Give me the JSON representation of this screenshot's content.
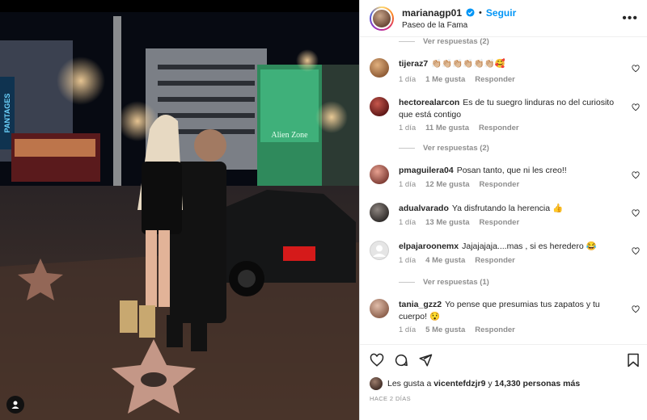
{
  "post": {
    "username": "marianagp01",
    "follow_label": "Seguir",
    "location": "Paseo de la Fama",
    "more_label": "•••",
    "separator": "•"
  },
  "photo": {
    "sign_text": "PANTAGES",
    "billboard_text": "Alien Zone"
  },
  "comments": [
    {
      "type": "replies",
      "label": "Ver respuestas (2)"
    },
    {
      "type": "comment",
      "user": "tijeraz7",
      "text": "👏🏼👏🏼👏🏼👏🏼👏🏼👏🏼🥰",
      "time": "1 día",
      "likes": "1 Me gusta",
      "reply": "Responder",
      "avatar": "#c58e5b"
    },
    {
      "type": "comment",
      "user": "hectorealarcon",
      "text": "Es de tu suegro linduras no del curiosito que está contigo",
      "time": "1 día",
      "likes": "11 Me gusta",
      "reply": "Responder",
      "avatar": "#8a2b2b"
    },
    {
      "type": "replies",
      "label": "Ver respuestas (2)"
    },
    {
      "type": "comment",
      "user": "pmaguilera04",
      "text": "Posan tanto, que ni les creo!!",
      "time": "1 día",
      "likes": "12 Me gusta",
      "reply": "Responder",
      "avatar": "#c9776b"
    },
    {
      "type": "comment",
      "user": "adualvarado",
      "text": "Ya disfrutando la herencia 👍",
      "time": "1 día",
      "likes": "13 Me gusta",
      "reply": "Responder",
      "avatar": "#5a5350"
    },
    {
      "type": "comment",
      "user": "elpajaroonemx",
      "text": "Jajajajaja....mas , si es heredero 😂",
      "time": "1 día",
      "likes": "4 Me gusta",
      "reply": "Responder",
      "avatar": "#dcdcdc"
    },
    {
      "type": "replies",
      "label": "Ver respuestas (1)"
    },
    {
      "type": "comment",
      "user": "tania_gzz2",
      "text": "Yo pense que presumias tus zapatos y tu cuerpo! 😯",
      "time": "1 día",
      "likes": "5 Me gusta",
      "reply": "Responder",
      "avatar": "#b98d7a"
    }
  ],
  "footer": {
    "likes_prefix": "Les gusta a",
    "likes_user": "vicentefdzjr9",
    "likes_conj": "y",
    "likes_others": "14,330 personas más",
    "time_ago": "HACE 2 DÍAS"
  },
  "colors": {
    "accent": "#0095f6",
    "muted": "#8e8e8e"
  },
  "icons": [
    "verified-icon",
    "more-icon",
    "heart-icon",
    "comment-icon",
    "share-icon",
    "bookmark-icon",
    "user-tag-icon"
  ]
}
